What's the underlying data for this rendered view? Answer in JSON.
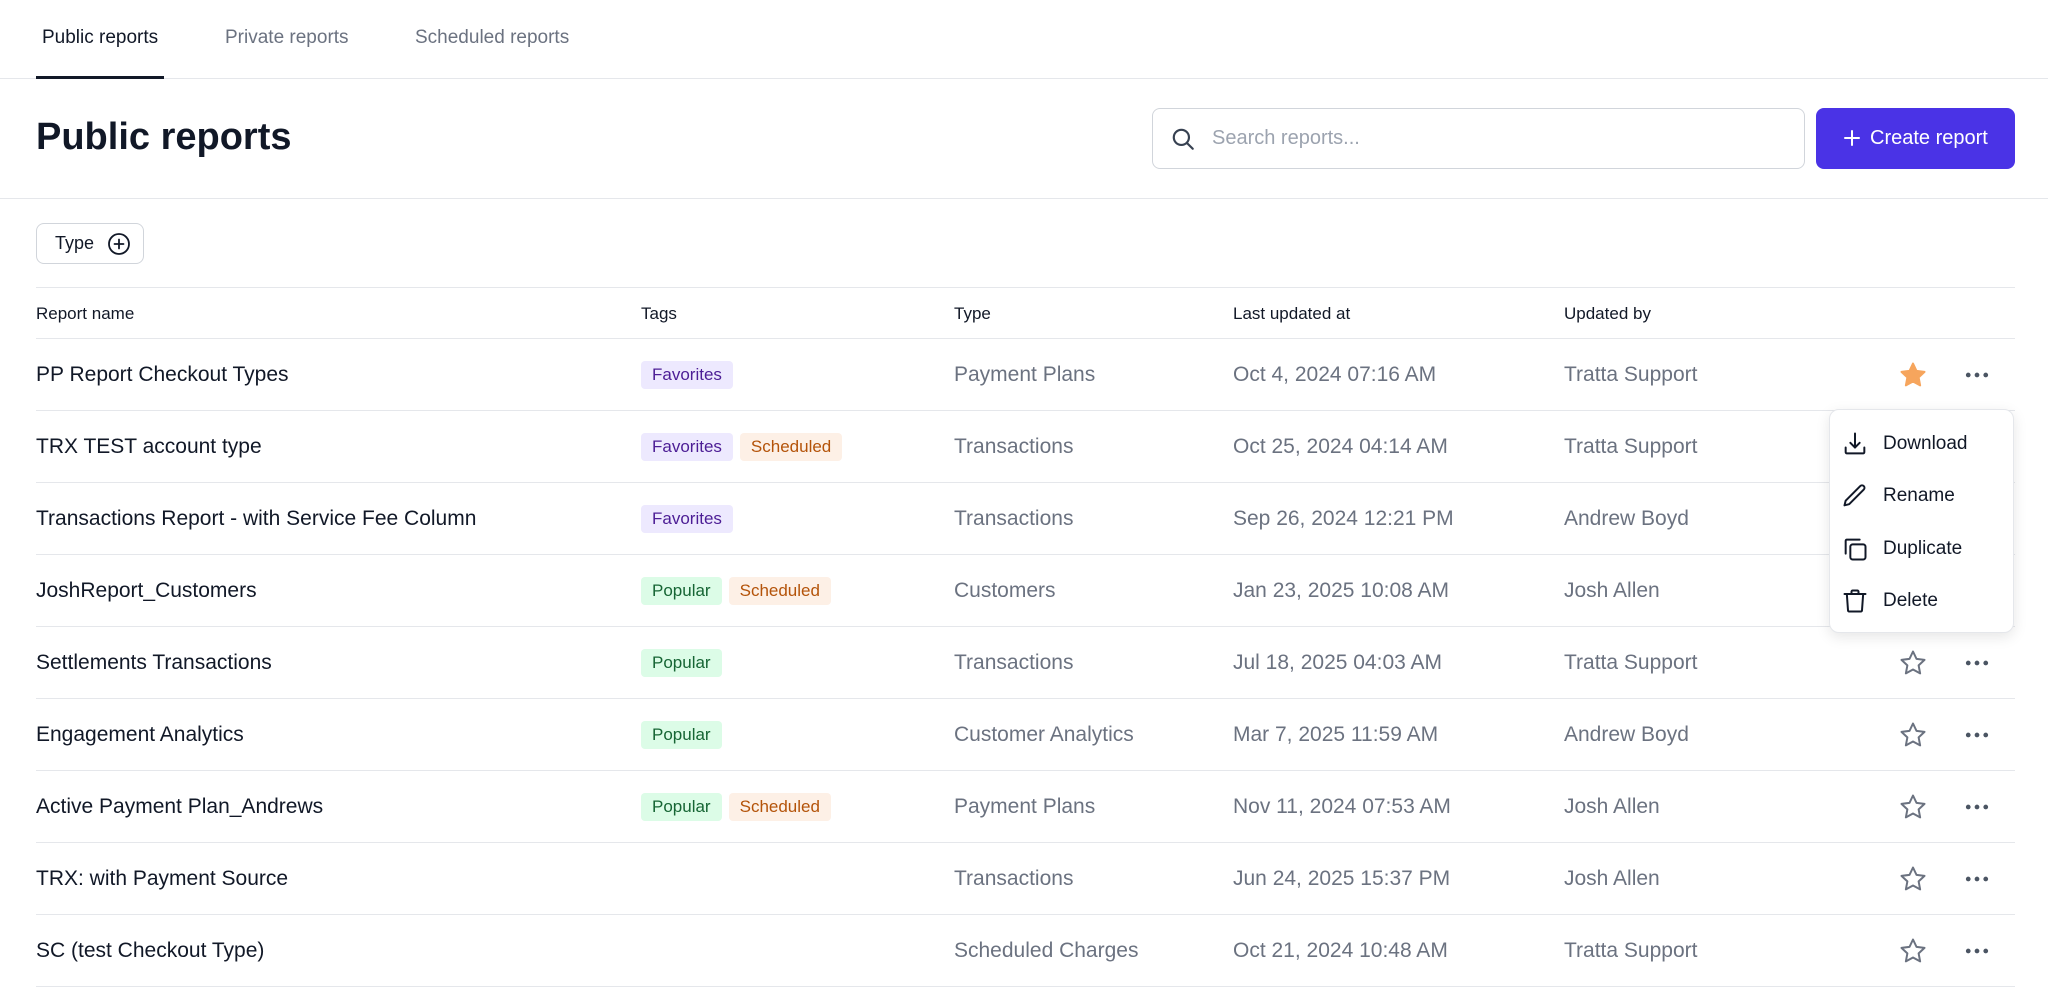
{
  "tabs": [
    {
      "label": "Public reports",
      "active": true
    },
    {
      "label": "Private reports",
      "active": false
    },
    {
      "label": "Scheduled reports",
      "active": false
    }
  ],
  "header": {
    "title": "Public reports"
  },
  "search": {
    "placeholder": "Search reports..."
  },
  "create_button": {
    "label": "Create report"
  },
  "filter": {
    "label": "Type"
  },
  "table": {
    "columns": [
      "Report name",
      "Tags",
      "Type",
      "Last updated at",
      "Updated by"
    ],
    "rows": [
      {
        "name": "PP Report Checkout Types",
        "tags": [
          "Favorites"
        ],
        "type": "Payment Plans",
        "updated_at": "Oct 4, 2024 07:16 AM",
        "updated_by": "Tratta Support",
        "favorite": true
      },
      {
        "name": "TRX TEST account type",
        "tags": [
          "Favorites",
          "Scheduled"
        ],
        "type": "Transactions",
        "updated_at": "Oct 25, 2024 04:14 AM",
        "updated_by": "Tratta Support",
        "favorite": false
      },
      {
        "name": "Transactions Report - with Service Fee Column",
        "tags": [
          "Favorites"
        ],
        "type": "Transactions",
        "updated_at": "Sep 26, 2024 12:21 PM",
        "updated_by": "Andrew Boyd",
        "favorite": false
      },
      {
        "name": "JoshReport_Customers",
        "tags": [
          "Popular",
          "Scheduled"
        ],
        "type": "Customers",
        "updated_at": "Jan 23, 2025 10:08 AM",
        "updated_by": "Josh Allen",
        "favorite": false
      },
      {
        "name": "Settlements Transactions",
        "tags": [
          "Popular"
        ],
        "type": "Transactions",
        "updated_at": "Jul 18, 2025 04:03 AM",
        "updated_by": "Tratta Support",
        "favorite": false
      },
      {
        "name": "Engagement Analytics",
        "tags": [
          "Popular"
        ],
        "type": "Customer Analytics",
        "updated_at": "Mar 7, 2025 11:59 AM",
        "updated_by": "Andrew Boyd",
        "favorite": false
      },
      {
        "name": "Active Payment Plan_Andrews",
        "tags": [
          "Popular",
          "Scheduled"
        ],
        "type": "Payment Plans",
        "updated_at": "Nov 11, 2024 07:53 AM",
        "updated_by": "Josh Allen",
        "favorite": false
      },
      {
        "name": "TRX: with Payment Source",
        "tags": [],
        "type": "Transactions",
        "updated_at": "Jun 24, 2025 15:37 PM",
        "updated_by": "Josh Allen",
        "favorite": false
      },
      {
        "name": "SC (test Checkout Type)",
        "tags": [],
        "type": "Scheduled Charges",
        "updated_at": "Oct 21, 2024 10:48 AM",
        "updated_by": "Tratta Support",
        "favorite": false
      }
    ]
  },
  "row_menu": {
    "items": [
      {
        "label": "Download",
        "icon": "download-icon"
      },
      {
        "label": "Rename",
        "icon": "pencil-icon"
      },
      {
        "label": "Duplicate",
        "icon": "copy-icon"
      },
      {
        "label": "Delete",
        "icon": "trash-icon"
      }
    ]
  },
  "tag_styles": {
    "Favorites": {
      "bg": "#ede9fe",
      "fg": "#4c1d95"
    },
    "Scheduled": {
      "bg": "#fdf0e6",
      "fg": "#b45309"
    },
    "Popular": {
      "bg": "#dcfce7",
      "fg": "#166534"
    }
  },
  "colors": {
    "accent": "#4a33e6",
    "star_filled": "#f6a55d",
    "star_outline": "#6b7280"
  }
}
